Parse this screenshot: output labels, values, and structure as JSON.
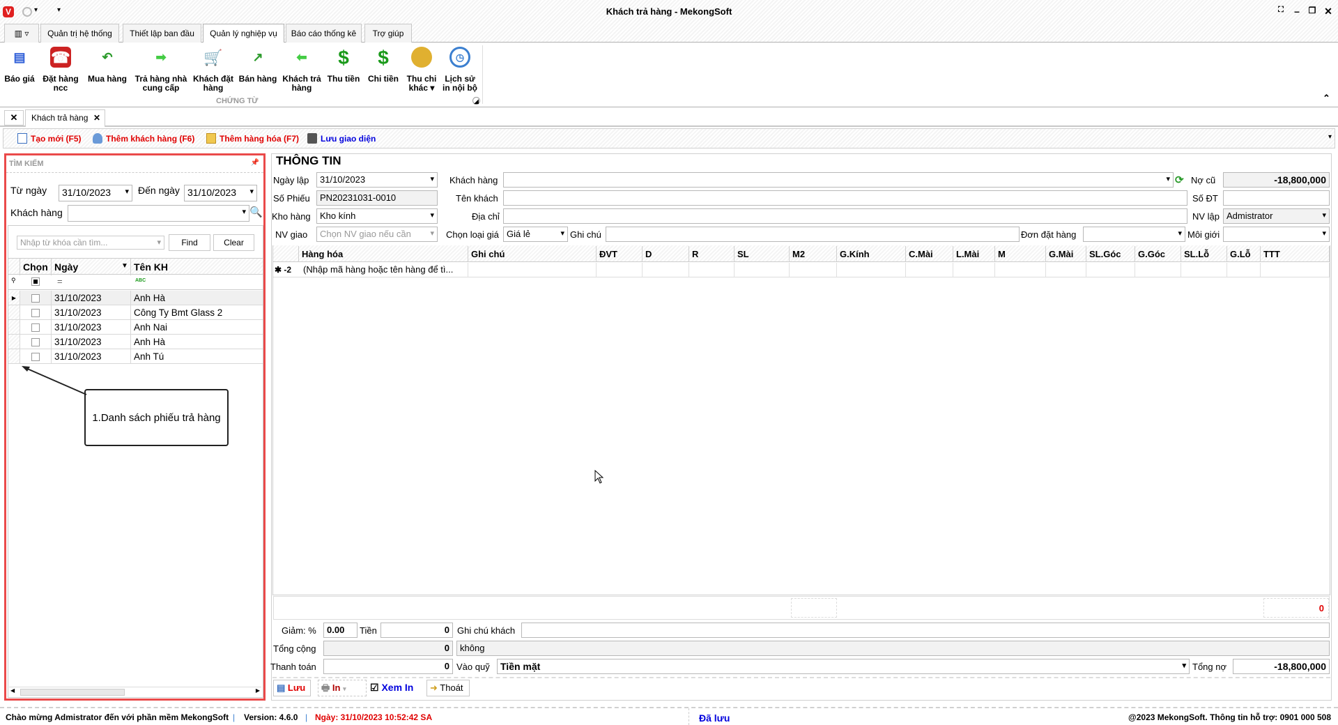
{
  "window": {
    "title": "Khách trả hàng - MekongSoft"
  },
  "ribbon_tabs": [
    "Quản trị hệ thống",
    "Thiết lập ban đầu",
    "Quản lý nghiệp vụ",
    "Báo cáo thống kê",
    "Trợ giúp"
  ],
  "ribbon": {
    "group_label": "CHỨNG TỪ",
    "buttons": [
      {
        "label": "Báo giá",
        "icon": "document-list-icon"
      },
      {
        "label": "Đặt hàng ncc",
        "icon": "telephone-icon"
      },
      {
        "label": "Mua hàng",
        "icon": "arrow-back-icon"
      },
      {
        "label": "Trả hàng nhà cung cấp",
        "icon": "arrow-right-icon"
      },
      {
        "label": "Khách đặt hàng",
        "icon": "cart-icon"
      },
      {
        "label": "Bán hàng",
        "icon": "arrow-up-right-icon"
      },
      {
        "label": "Khách trả hàng",
        "icon": "arrow-left-icon"
      },
      {
        "label": "Thu tiền",
        "icon": "dollar-plus-icon"
      },
      {
        "label": "Chi tiền",
        "icon": "dollar-minus-icon"
      },
      {
        "label": "Thu chi khác ▾",
        "icon": "coins-icon"
      },
      {
        "label": "Lịch sử in nội bộ",
        "icon": "history-icon"
      }
    ]
  },
  "doc_tab": "Khách trả hàng",
  "toolbar": {
    "new": "Tạo mới (F5)",
    "add_customer": "Thêm khách hàng (F6)",
    "add_product": "Thêm hàng hóa (F7)",
    "save_layout": "Lưu giao diện"
  },
  "search": {
    "title": "TÌM KIẾM",
    "from_label": "Từ ngày",
    "from": "31/10/2023",
    "to_label": "Đến ngày",
    "to": "31/10/2023",
    "customer_label": "Khách hàng",
    "keyword_placeholder": "Nhập từ khóa cần tìm...",
    "find": "Find",
    "clear": "Clear",
    "columns": [
      "Chọn",
      "Ngày",
      "Tên KH"
    ],
    "filter_eq": "=",
    "filter_abc": "ABC",
    "rows": [
      {
        "date": "31/10/2023",
        "name": "Anh Hà"
      },
      {
        "date": "31/10/2023",
        "name": "Công Ty Bmt Glass 2"
      },
      {
        "date": "31/10/2023",
        "name": "Anh Nai"
      },
      {
        "date": "31/10/2023",
        "name": "Anh Hà"
      },
      {
        "date": "31/10/2023",
        "name": "Anh Tú"
      }
    ],
    "annotation": "1.Danh sách phiếu trả hàng"
  },
  "info": {
    "title": "THÔNG TIN",
    "date_label": "Ngày lập",
    "date": "31/10/2023",
    "customer_label": "Khách hàng",
    "old_debt_label": "Nợ cũ",
    "old_debt": "-18,800,000",
    "voucher_label": "Số Phiếu",
    "voucher": "PN20231031-0010",
    "name_label": "Tên khách",
    "phone_label": "Số ĐT",
    "warehouse_label": "Kho hàng",
    "warehouse": "Kho kính",
    "address_label": "Địa chỉ",
    "staff_label": "NV lập",
    "staff": "Admistrator",
    "delivery_label": "NV giao",
    "delivery_placeholder": "Chọn NV giao nếu cần",
    "price_type_label": "Chọn loại giá",
    "price_type": "Giá lẻ",
    "note_label": "Ghi chú",
    "order_label": "Đơn đặt hàng",
    "broker_label": "Môi giới"
  },
  "items_grid": {
    "columns": [
      "Hàng hóa",
      "Ghi chú",
      "ĐVT",
      "D",
      "R",
      "SL",
      "M2",
      "G.Kính",
      "C.Mài",
      "L.Mài",
      "M",
      "G.Mài",
      "SL.Góc",
      "G.Góc",
      "SL.Lỗ",
      "G.Lỗ",
      "TTT"
    ],
    "new_row_marker": "✱ -2",
    "new_row_hint": "(Nhập mã hàng hoặc tên hàng để tì...",
    "total": "0"
  },
  "summary": {
    "discount_label": "Giảm: %",
    "discount": "0.00",
    "amount_label": "Tiền",
    "amount": "0",
    "customer_note_label": "Ghi chú khách",
    "total_label": "Tổng cộng",
    "total": "0",
    "total_words": "không",
    "paid_label": "Thanh toán",
    "paid": "0",
    "fund_label": "Vào quỹ",
    "fund": "Tiền mặt",
    "debt_label": "Tổng nợ",
    "debt": "-18,800,000"
  },
  "actions": {
    "save": "Lưu",
    "print": "In",
    "preview": "Xem In",
    "exit": "Thoát"
  },
  "status": {
    "welcome": "Chào mừng Admistrator đến với phần mềm MekongSoft",
    "version": "Version: 4.6.0",
    "date": "Ngày: 31/10/2023 10:52:42 SA",
    "saved": "Đã lưu",
    "copyright": "@2023 MekongSoft. Thông tin hỗ trợ: 0901 000 508"
  },
  "colors": {
    "red": "#e00000",
    "blue": "#0000dd",
    "highlight": "#ea4a4a"
  }
}
